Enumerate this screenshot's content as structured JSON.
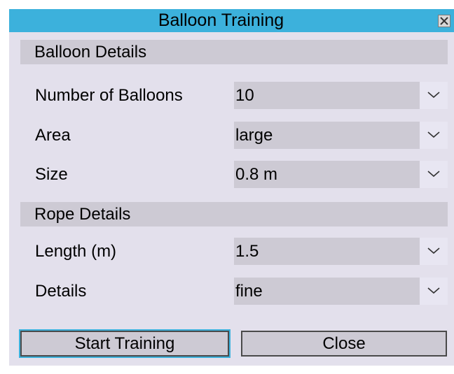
{
  "window": {
    "title": "Balloon Training"
  },
  "balloon_section": {
    "heading": "Balloon Details",
    "fields": [
      {
        "label": "Number of Balloons",
        "value": "10"
      },
      {
        "label": "Area",
        "value": "large"
      },
      {
        "label": "Size",
        "value": "0.8 m"
      }
    ]
  },
  "rope_section": {
    "heading": "Rope Details",
    "fields": [
      {
        "label": "Length (m)",
        "value": "1.5"
      },
      {
        "label": "Details",
        "value": "fine"
      }
    ]
  },
  "buttons": {
    "start": "Start Training",
    "close": "Close"
  },
  "icons": {
    "close": "close-icon",
    "dropdown": "chevron-down-icon"
  },
  "colors": {
    "titlebar": "#3cb1dc",
    "window_bg": "#e3e0ec",
    "field_bg": "#cdcad4"
  }
}
